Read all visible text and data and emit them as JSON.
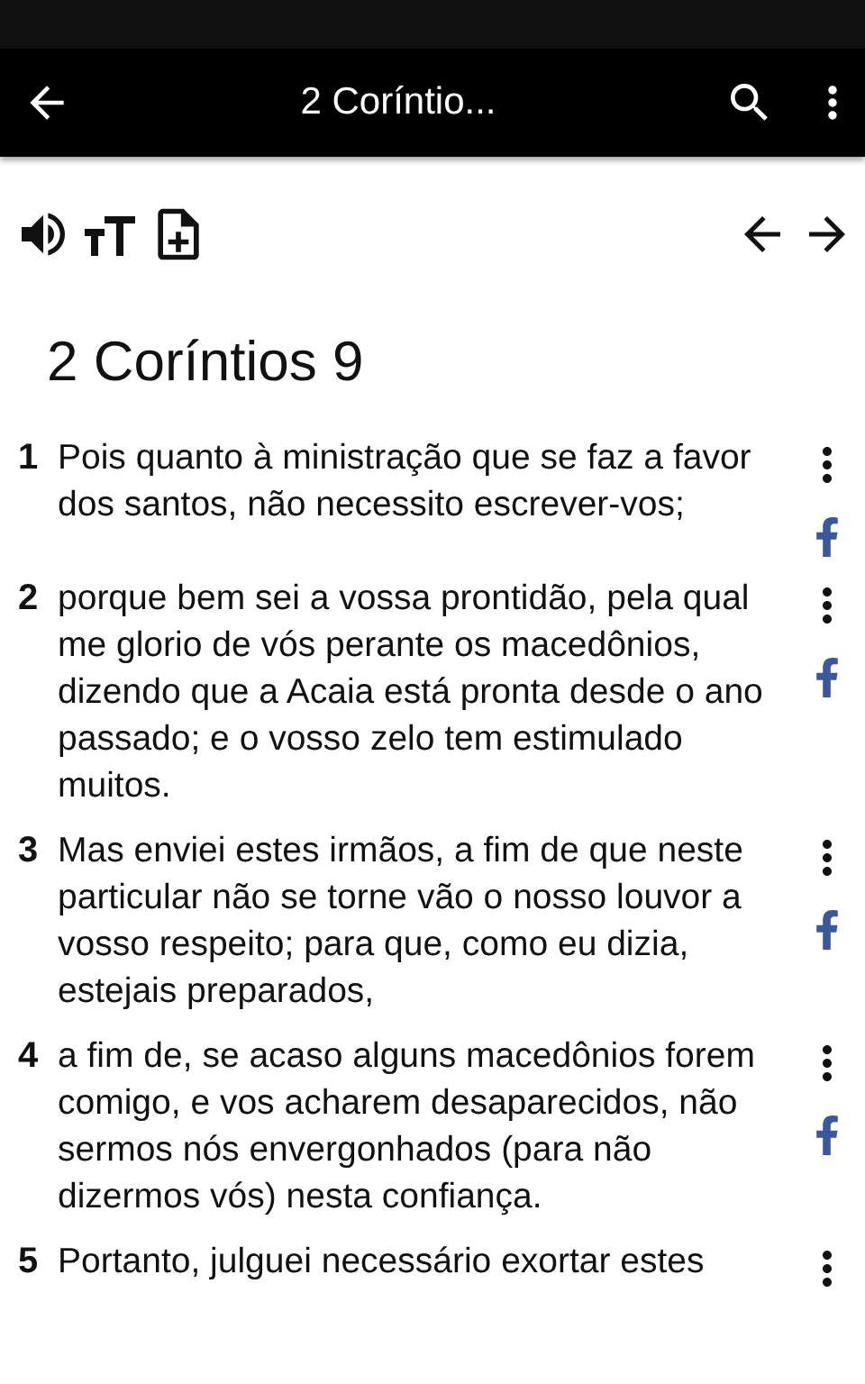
{
  "app_bar": {
    "title": "2 Coríntio..."
  },
  "chapter_title": "2 Coríntios 9",
  "verses": [
    {
      "number": "1",
      "text": "Pois quanto à ministração que se faz a favor dos santos, não necessito escrever-vos;"
    },
    {
      "number": "2",
      "text": "porque bem sei a vossa prontidão, pela qual me glorio de vós perante os macedônios, dizendo que a Acaia está pronta desde o ano passado; e o vosso zelo tem estimulado muitos."
    },
    {
      "number": "3",
      "text": "Mas enviei estes irmãos, a fim de que neste particular não se torne vão o nosso louvor a vosso respeito; para que, como eu dizia, estejais preparados,"
    },
    {
      "number": "4",
      "text": "a fim de, se acaso alguns macedônios forem comigo, e vos acharem desaparecidos, não sermos nós envergonhados (para não dizermos vós) nesta confiança."
    },
    {
      "number": "5",
      "text": "Portanto, julguei necessário exortar estes"
    }
  ]
}
